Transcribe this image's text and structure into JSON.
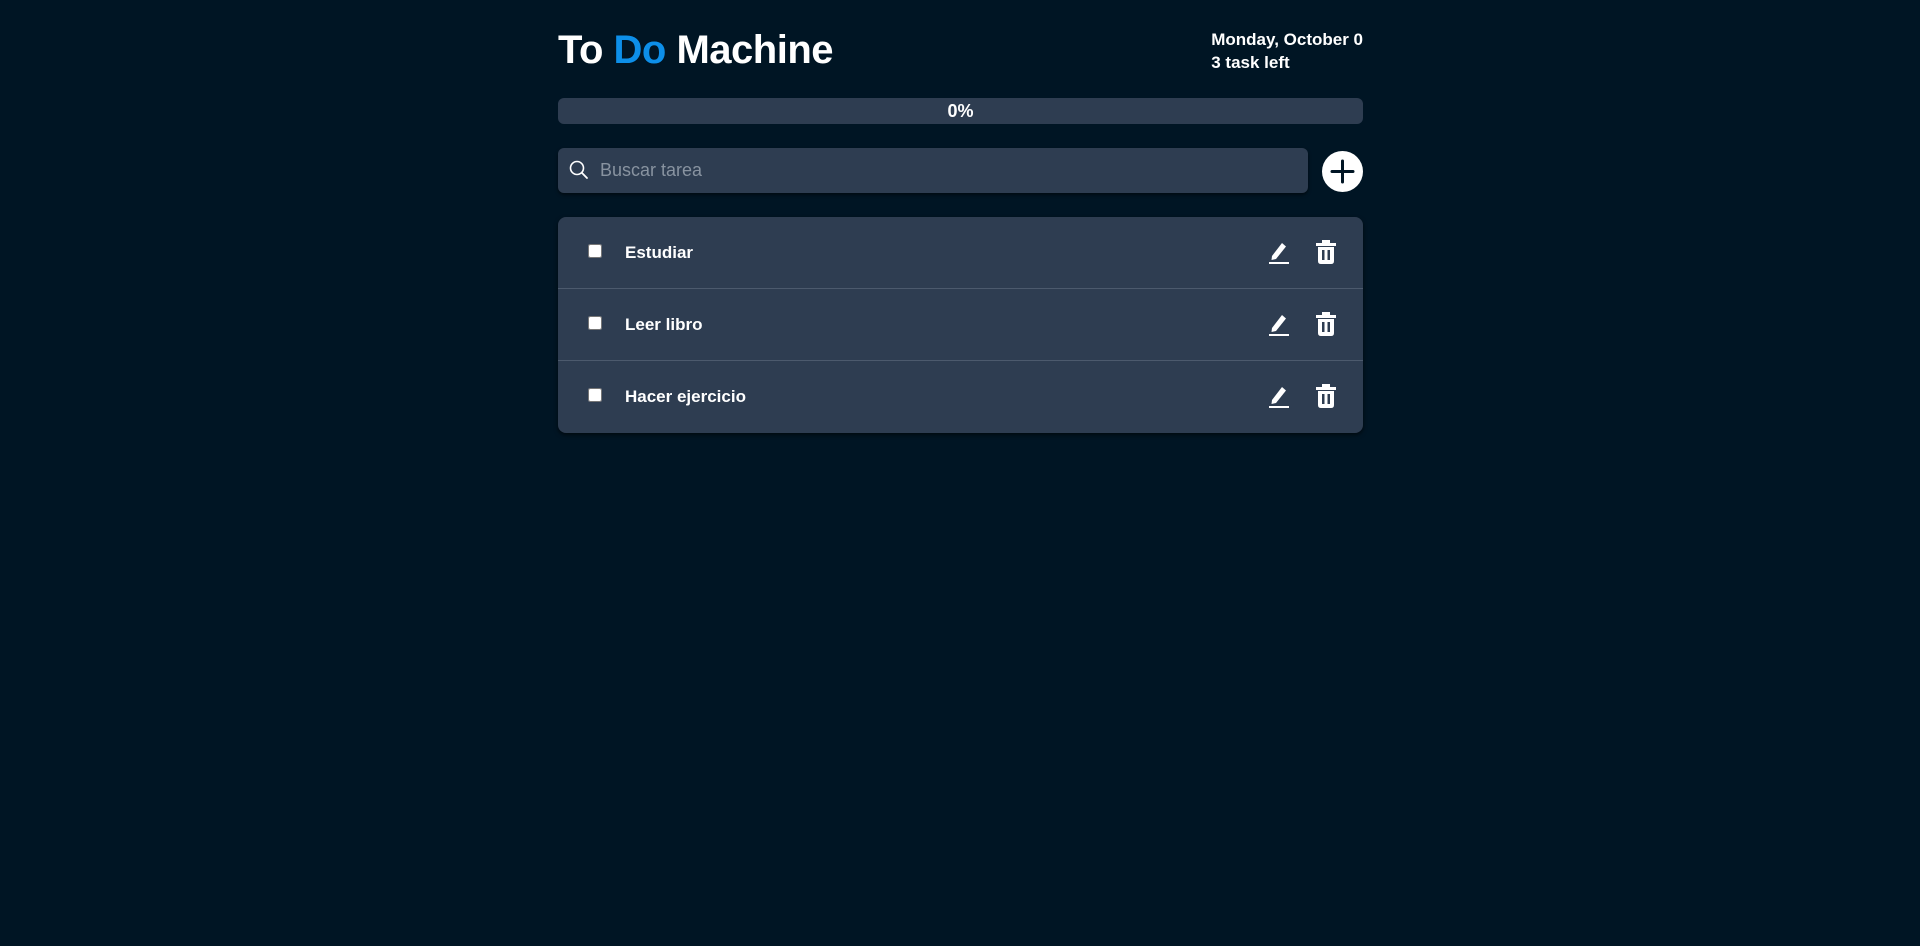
{
  "header": {
    "title_part1": "To ",
    "title_accent": "Do",
    "title_part2": " Machine",
    "date": "Monday, October 0",
    "tasks_left": "3 task left"
  },
  "progress": {
    "label": "0%",
    "value_percent": 0
  },
  "search": {
    "placeholder": "Buscar tarea",
    "value": ""
  },
  "todos": [
    {
      "text": "Estudiar",
      "completed": false
    },
    {
      "text": "Leer libro",
      "completed": false
    },
    {
      "text": "Hacer ejercicio",
      "completed": false
    }
  ],
  "icons": {
    "search": "search-icon",
    "add": "plus-icon",
    "edit": "pencil-icon",
    "delete": "trash-icon"
  },
  "colors": {
    "background": "#001524",
    "card": "#2e3d51",
    "accent": "#0d8fe9",
    "text": "#ffffff"
  }
}
